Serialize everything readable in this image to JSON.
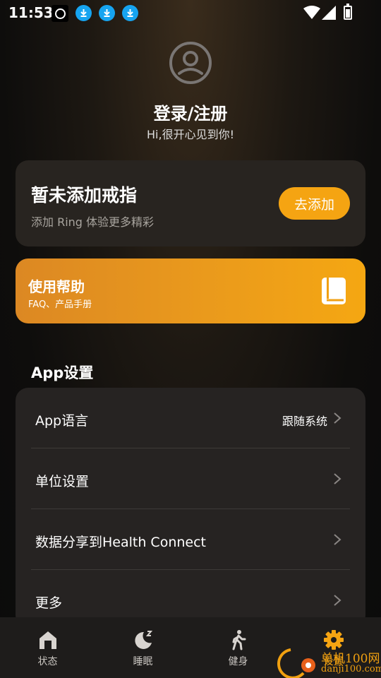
{
  "status_bar": {
    "time": "11:53",
    "icons": [
      "ring-app-icon",
      "download-icon",
      "download-icon",
      "download-icon",
      "wifi-icon",
      "signal-icon",
      "battery-charging-icon"
    ]
  },
  "profile": {
    "login_title": "登录/注册",
    "greeting": "Hi,很开心见到你!"
  },
  "ring_card": {
    "title": "暂未添加戒指",
    "subtitle": "添加 Ring 体验更多精彩",
    "add_button": "去添加"
  },
  "help_card": {
    "title": "使用帮助",
    "subtitle": "FAQ、产品手册",
    "icon": "book-icon"
  },
  "app_settings": {
    "section_title": "App设置",
    "rows": [
      {
        "label": "App语言",
        "value": "跟随系统"
      },
      {
        "label": "单位设置",
        "value": ""
      },
      {
        "label": "数据分享到Health Connect",
        "value": ""
      },
      {
        "label": "更多",
        "value": ""
      }
    ]
  },
  "bottom_nav": {
    "items": [
      {
        "label": "状态",
        "icon": "home-icon"
      },
      {
        "label": "睡眠",
        "icon": "moon-icon"
      },
      {
        "label": "健身",
        "icon": "walking-icon"
      },
      {
        "label": "设置",
        "icon": "gear-icon"
      }
    ],
    "active_index": 3
  },
  "watermark": {
    "line1": "单机100网",
    "line2": "danji100.com"
  },
  "colors": {
    "accent": "#f5a412",
    "card": "#282420",
    "download_badge": "#16a4f0"
  }
}
